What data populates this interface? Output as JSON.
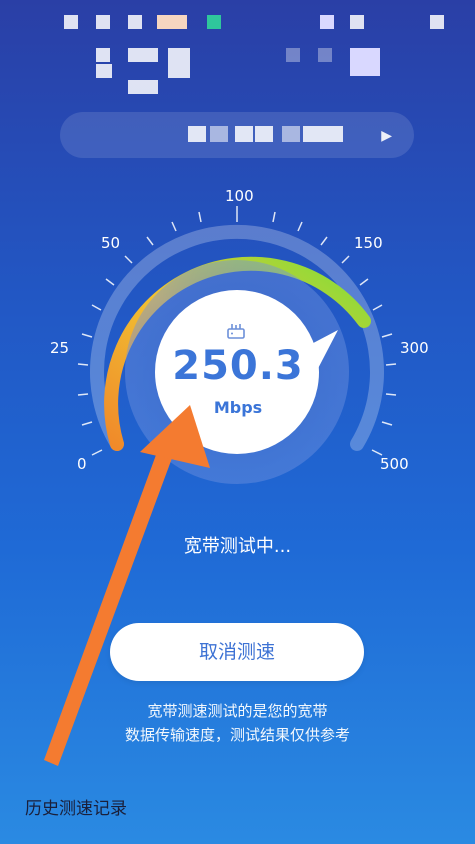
{
  "gauge": {
    "ticks": [
      "0",
      "25",
      "50",
      "100",
      "150",
      "300",
      "500"
    ],
    "speed_value": "250.3",
    "speed_unit": "Mbps"
  },
  "status": {
    "testing_text": "宽带测试中..."
  },
  "actions": {
    "cancel_label": "取消测速"
  },
  "description": {
    "line1": "宽带测速测试的是您的宽带",
    "line2": "数据传输速度，测试结果仅供参考"
  },
  "footer": {
    "history_label": "历史测速记录"
  },
  "colors": {
    "accent": "#3b75d8",
    "arc_start": "#f08a2a",
    "arc_mid": "#f1c232",
    "arc_end": "#7be03a",
    "annotation": "#f47b30"
  },
  "icons": {
    "router": "router-icon",
    "network_arrow": "chevron-right-icon"
  }
}
